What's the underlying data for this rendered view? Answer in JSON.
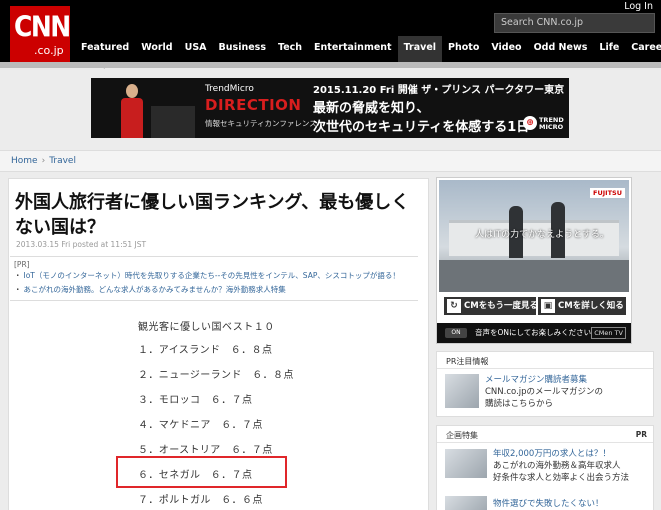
{
  "header": {
    "logo_main": "CNN",
    "logo_sub": ".co.jp",
    "login": "Log In",
    "search_placeholder": "Search CNN.co.jp",
    "nav": [
      {
        "label": "Featured",
        "active": false
      },
      {
        "label": "World",
        "active": false
      },
      {
        "label": "USA",
        "active": false
      },
      {
        "label": "Business",
        "active": false
      },
      {
        "label": "Tech",
        "active": false
      },
      {
        "label": "Entertainment",
        "active": false
      },
      {
        "label": "Travel",
        "active": true
      },
      {
        "label": "Photo",
        "active": false
      },
      {
        "label": "Video",
        "active": false
      },
      {
        "label": "Odd News",
        "active": false
      },
      {
        "label": "Life",
        "active": false
      },
      {
        "label": "Career",
        "active": false
      }
    ]
  },
  "banner": {
    "brand": "TrendMicro",
    "direction": "DIRECTION",
    "sub": "情報セキュリティカンファレンス",
    "line1": "2015.11.20 Fri 開催 ザ・プリンス パークタワー東京",
    "line2": "最新の脅威を知り、",
    "line3": "次世代のセキュリティを体感する1日",
    "logo_text": "TREND MICRO"
  },
  "breadcrumb": {
    "home": "Home",
    "current": "Travel"
  },
  "article": {
    "title": "外国人旅行者に優しい国ランキング、最も優しくない国は？",
    "date": "2013.03.15 Fri posted at 11:51 JST",
    "pr_tag": "[PR]",
    "pr_links": [
      "IoT（モノのインターネット）時代を先取りする企業たち--その先見性をインテル、SAP、シスコトップが語る！",
      "あこがれの海外勤務。どんな求人があるかみてみませんか？海外勤務求人特集"
    ],
    "list_heading": "観光客に優しい国ベスト１０",
    "ranking": [
      "１．アイスランド　６．８点",
      "２．ニュージーランド　６．８点",
      "３．モロッコ　６．７点",
      "４．マケドニア　６．７点",
      "５．オーストリア　６．７点",
      "６．セネガル　６．７点",
      "７．ポルトガル　６．６点"
    ]
  },
  "sidebar": {
    "video": {
      "brand": "FUJITSU",
      "caption": "人はITの力でかなえようとする。",
      "btn_replay": "CMをもう一度見る",
      "btn_details": "CMを詳しく知る",
      "sound_on": "ON",
      "sound_msg": "音声をONにしてお楽しみください",
      "cmen": "CMen TV"
    },
    "pr_box": {
      "heading": "PR注目情報",
      "title": "メールマガジン購読者募集",
      "line2": "CNN.co.jpのメールマガジンの",
      "line3": "購読はこちらから"
    },
    "feature_box": {
      "heading": "企画特集",
      "pr": "PR",
      "line1": "年収2,000万円の求人とは？！",
      "line2": "あこがれの海外勤務＆高年収求人",
      "line3": "好条件な求人と効率よく出会う方法",
      "line4": "物件選びで失敗したくない！"
    }
  }
}
